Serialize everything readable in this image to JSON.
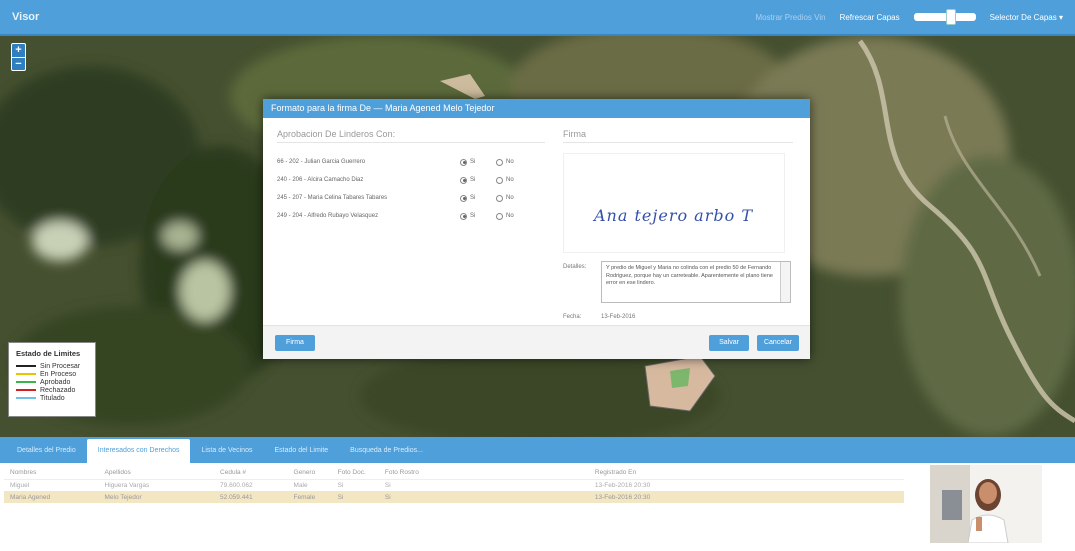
{
  "app": {
    "title": "Visor",
    "hint": "Mostrar Predios Vin",
    "reload_label": "Refrescar Capas",
    "layers_label": "Selector De Capas"
  },
  "map": {
    "zoom_in": "+",
    "zoom_out": "−",
    "legend": {
      "title": "Estado de Limites",
      "items": [
        {
          "label": "Sin Procesar",
          "color": "#222222"
        },
        {
          "label": "En Proceso",
          "color": "#e8c300"
        },
        {
          "label": "Aprobado",
          "color": "#3cb44b"
        },
        {
          "label": "Rechazado",
          "color": "#d42020"
        },
        {
          "label": "Titulado",
          "color": "#6fc1ea"
        }
      ]
    }
  },
  "modal": {
    "title": "Formato para la firma De — Maria Agened Melo Tejedor",
    "linderos_title": "Aprobacion De Linderos Con:",
    "yes_label": "Si",
    "no_label": "No",
    "linderos": [
      {
        "label": "66 - 202 - Julian Garcia Guerrero",
        "value": "si"
      },
      {
        "label": "240 - 206 - Alcira Camacho Diaz",
        "value": "si"
      },
      {
        "label": "245 - 207 - Maria Celina Tabares Tabares",
        "value": "si"
      },
      {
        "label": "249 - 204 - Alfredo Rubayo Velasquez",
        "value": "si"
      }
    ],
    "firma_title": "Firma",
    "signature": "Ana tejero arbo T",
    "detalles_label": "Detalles:",
    "detalles_text": "Y predio de Miguel y Maria no colinda con el predio 50 de Fernando Rodriguez, porque hay un carreteable. Aparentemente el plano tiene error en ese lindero.",
    "fecha_label": "Fecha:",
    "fecha_value": "13-Feb-2016",
    "firma_button": "Firma",
    "save_button": "Salvar",
    "cancel_button": "Cancelar"
  },
  "bottom": {
    "tabs": [
      "Detalles del Predio",
      "Interesados con Derechos",
      "Lista de Vecinos",
      "Estado del Limite",
      "Busqueda de Predios..."
    ],
    "active_tab": 1,
    "columns": [
      "Nombres",
      "Apellidos",
      "Cedula #",
      "Genero",
      "Foto Doc.",
      "Foto Rostro",
      "Registrado En"
    ],
    "rows": [
      [
        "Miguel",
        "Higuera Vargas",
        "79.600.062",
        "Male",
        "Si",
        "Si",
        "13-Feb-2016 20:30"
      ],
      [
        "Maria Agened",
        "Melo Tejedor",
        "52.059.441",
        "Female",
        "Si",
        "Si",
        "13-Feb-2016 20:30"
      ]
    ],
    "selected_row": 1
  }
}
